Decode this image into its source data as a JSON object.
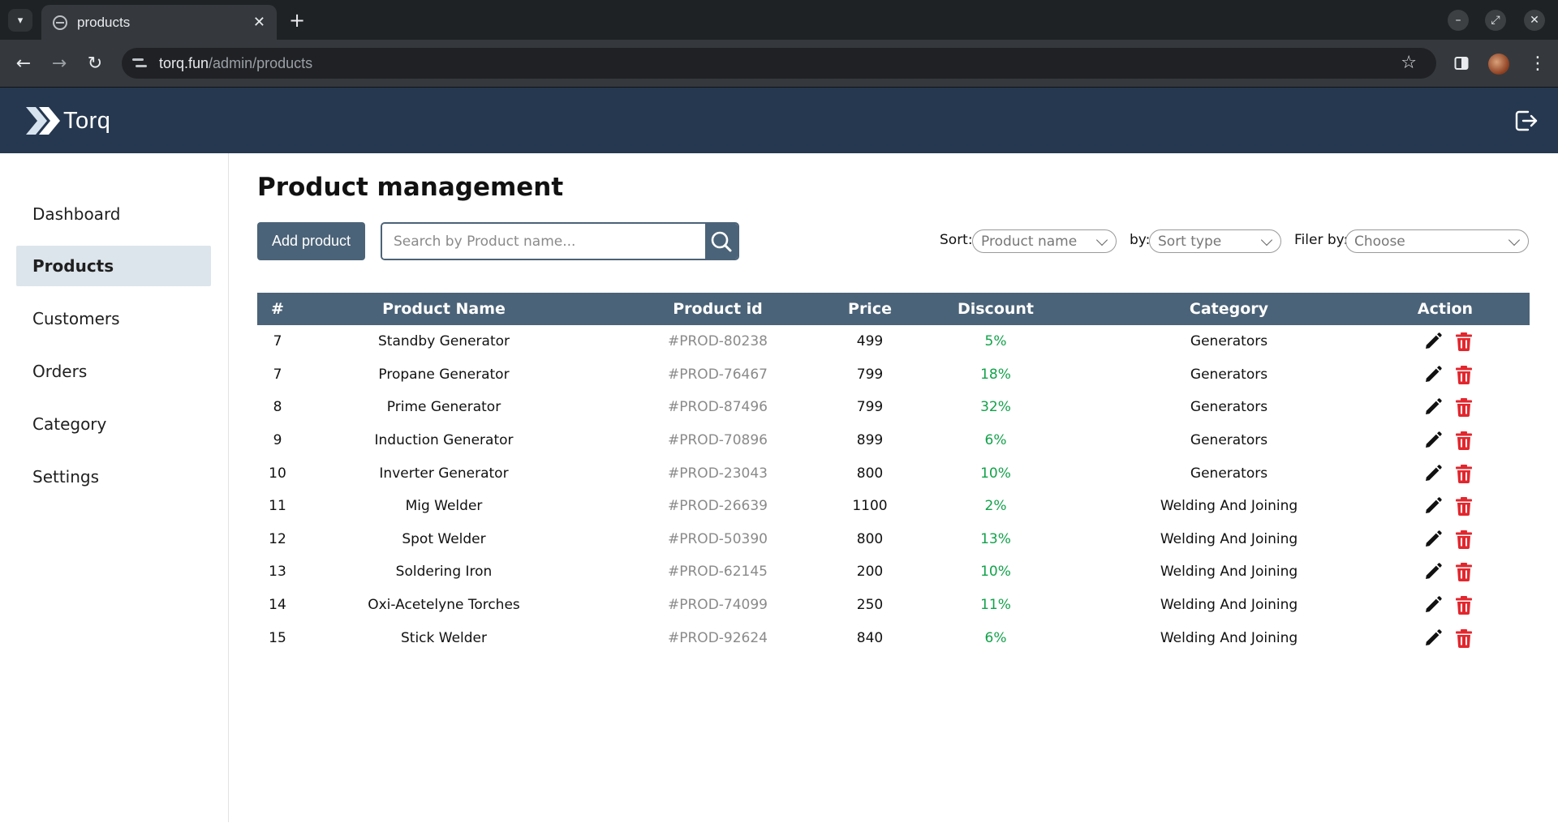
{
  "browser": {
    "tab_title": "products",
    "url_host": "torq.fun",
    "url_path": "/admin/products"
  },
  "app": {
    "logo_text": "Torq"
  },
  "sidebar": {
    "items": [
      {
        "label": "Dashboard"
      },
      {
        "label": "Products"
      },
      {
        "label": "Customers"
      },
      {
        "label": "Orders"
      },
      {
        "label": "Category"
      },
      {
        "label": "Settings"
      }
    ],
    "active": "Products"
  },
  "main": {
    "title": "Product management",
    "add_button": "Add product",
    "search_placeholder": "Search by Product name...",
    "sort_label": "Sort:",
    "sort_value": "Product name",
    "by_label": "by:",
    "by_value": "Sort type",
    "filter_label": "Filer by:",
    "filter_value": "Choose"
  },
  "table": {
    "headers": [
      "#",
      "Product Name",
      "Product id",
      "Price",
      "Discount",
      "Category",
      "Action"
    ],
    "rows": [
      {
        "num": "7",
        "name": "Standby Generator",
        "id": "#PROD-80238",
        "price": "499",
        "discount": "5%",
        "category": "Generators"
      },
      {
        "num": "7",
        "name": "Propane Generator",
        "id": "#PROD-76467",
        "price": "799",
        "discount": "18%",
        "category": "Generators"
      },
      {
        "num": "8",
        "name": "Prime Generator",
        "id": "#PROD-87496",
        "price": "799",
        "discount": "32%",
        "category": "Generators"
      },
      {
        "num": "9",
        "name": "Induction Generator",
        "id": "#PROD-70896",
        "price": "899",
        "discount": "6%",
        "category": "Generators"
      },
      {
        "num": "10",
        "name": "Inverter Generator",
        "id": "#PROD-23043",
        "price": "800",
        "discount": "10%",
        "category": "Generators"
      },
      {
        "num": "11",
        "name": "Mig Welder",
        "id": "#PROD-26639",
        "price": "1100",
        "discount": "2%",
        "category": "Welding And Joining"
      },
      {
        "num": "12",
        "name": "Spot Welder",
        "id": "#PROD-50390",
        "price": "800",
        "discount": "13%",
        "category": "Welding And Joining"
      },
      {
        "num": "13",
        "name": "Soldering Iron",
        "id": "#PROD-62145",
        "price": "200",
        "discount": "10%",
        "category": "Welding And Joining"
      },
      {
        "num": "14",
        "name": "Oxi-Acetelyne Torches",
        "id": "#PROD-74099",
        "price": "250",
        "discount": "11%",
        "category": "Welding And Joining"
      },
      {
        "num": "15",
        "name": "Stick Welder",
        "id": "#PROD-92624",
        "price": "840",
        "discount": "6%",
        "category": "Welding And Joining"
      }
    ]
  },
  "icons": {
    "edit": "pencil-icon",
    "delete": "trash-icon",
    "search": "search-icon",
    "logout": "logout-icon"
  },
  "colors": {
    "header_bg": "#263850",
    "accent": "#4b6378",
    "discount": "#12a24a",
    "delete": "#e3262d"
  }
}
